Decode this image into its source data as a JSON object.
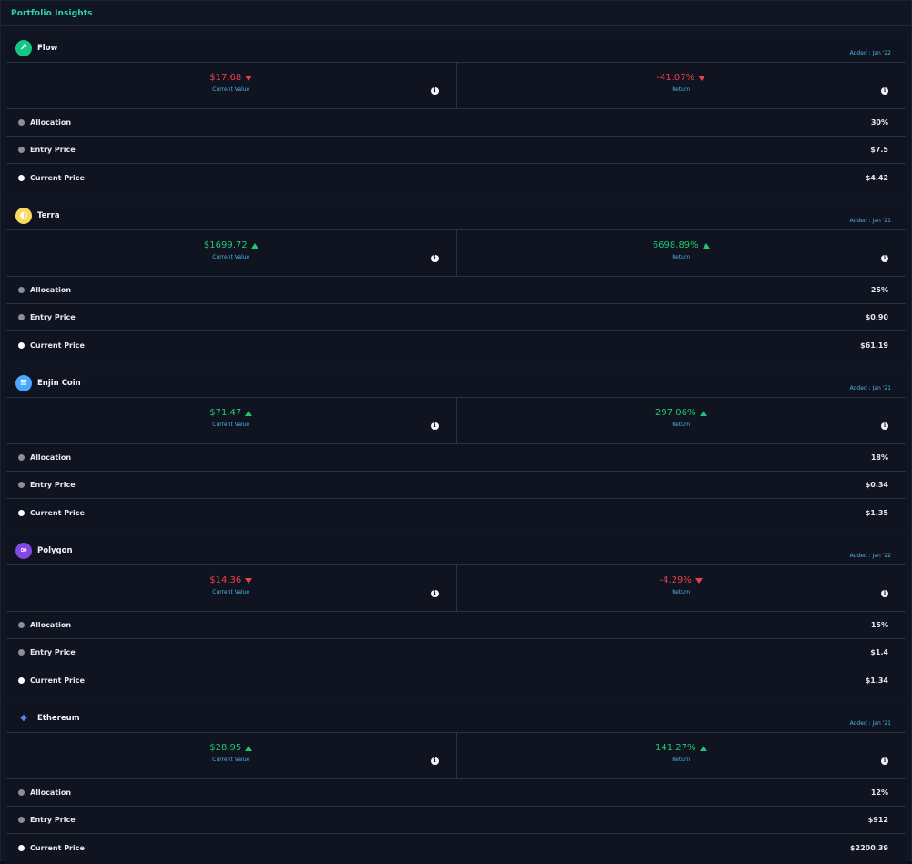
{
  "header": {
    "title": "Portfolio Insights"
  },
  "labels": {
    "current_value": "Current Value",
    "return": "Return",
    "allocation": "Allocation",
    "entry_price": "Entry Price",
    "current_price": "Current Price"
  },
  "coins": [
    {
      "name": "Flow",
      "added": "Added : Jan '22",
      "icon": "flow-icon",
      "icon_color": "#16c784",
      "current_value": "$17.68",
      "current_dir": "down",
      "return": "-41.07%",
      "return_dir": "down",
      "allocation": "30%",
      "entry_price": "$7.5",
      "current_price": "$4.42"
    },
    {
      "name": "Terra",
      "added": "Added : Jan '21",
      "icon": "terra-icon",
      "icon_color": "#f9d85e",
      "current_value": "$1699.72",
      "current_dir": "up",
      "return": "6698.89%",
      "return_dir": "up",
      "allocation": "25%",
      "entry_price": "$0.90",
      "current_price": "$61.19"
    },
    {
      "name": "Enjin Coin",
      "added": "Added : Jan '21",
      "icon": "enjin-icon",
      "icon_color": "#4aa8ff",
      "current_value": "$71.47",
      "current_dir": "up",
      "return": "297.06%",
      "return_dir": "up",
      "allocation": "18%",
      "entry_price": "$0.34",
      "current_price": "$1.35"
    },
    {
      "name": "Polygon",
      "added": "Added : Jan '22",
      "icon": "polygon-icon",
      "icon_color": "#8247e5",
      "current_value": "$14.36",
      "current_dir": "down",
      "return": "-4.29%",
      "return_dir": "down",
      "allocation": "15%",
      "entry_price": "$1.4",
      "current_price": "$1.34"
    },
    {
      "name": "Ethereum",
      "added": "Added : Jan '21",
      "icon": "ethereum-icon",
      "icon_color": "#627eea",
      "current_value": "$28.95",
      "current_dir": "up",
      "return": "141.27%",
      "return_dir": "up",
      "allocation": "12%",
      "entry_price": "$912",
      "current_price": "$2200.39"
    }
  ]
}
